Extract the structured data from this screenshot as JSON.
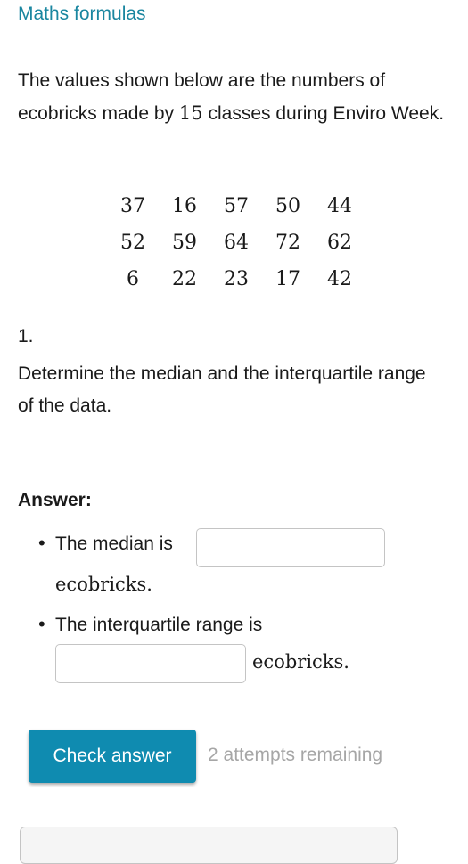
{
  "header": {
    "link_label": "Maths formulas"
  },
  "intro": {
    "before": "The values shown below are the numbers of ecobricks made by ",
    "count": "15",
    "after": " classes during Enviro Week."
  },
  "data_values": [
    [
      "37",
      "16",
      "57",
      "50",
      "44"
    ],
    [
      "52",
      "59",
      "64",
      "72",
      "62"
    ],
    [
      "6",
      "22",
      "23",
      "17",
      "42"
    ]
  ],
  "question": {
    "number": "1.",
    "text": "Determine the median and the interquartile range of the data."
  },
  "answer": {
    "label": "Answer:",
    "median_prefix": "The median is",
    "median_value": "",
    "median_suffix": "ecobricks.",
    "iqr_prefix": "The interquartile range is",
    "iqr_value": "",
    "iqr_suffix": "ecobricks."
  },
  "actions": {
    "check_label": "Check answer",
    "attempts": "2 attempts remaining"
  },
  "colors": {
    "accent": "#0f8bb0",
    "link": "#1a86a0",
    "muted": "#a6a6a6"
  }
}
